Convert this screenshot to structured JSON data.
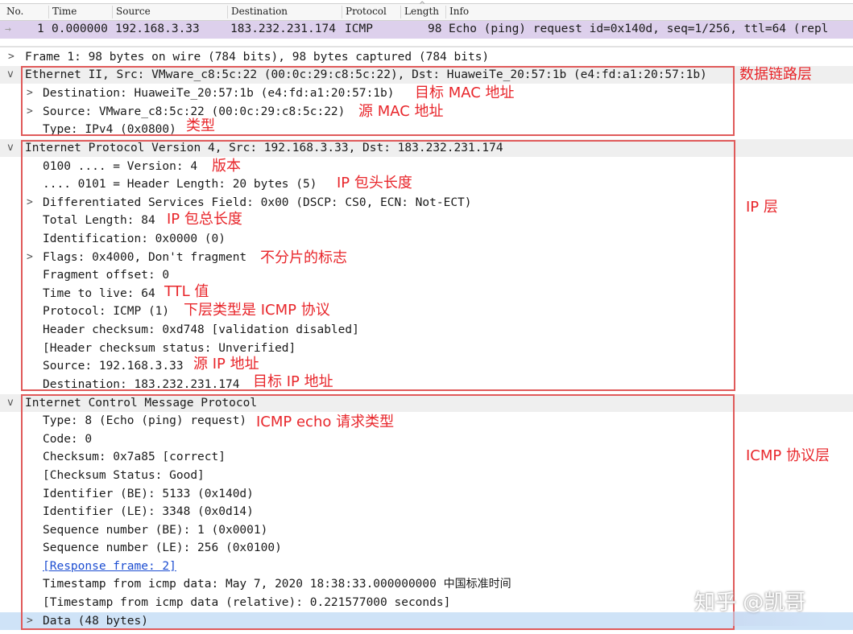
{
  "packet_list": {
    "columns": [
      "No.",
      "Time",
      "Source",
      "Destination",
      "Protocol",
      "Length",
      "Info"
    ],
    "selected_row": {
      "no": "1",
      "time": "0.000000",
      "source": "192.168.3.33",
      "destination": "183.232.231.174",
      "protocol": "ICMP",
      "length": "98",
      "info": "Echo (ping) request  id=0x140d, seq=1/256, ttl=64 (repl"
    }
  },
  "details": {
    "frame": "Frame 1: 98 bytes on wire (784 bits), 98 bytes captured (784 bits)",
    "ethernet": {
      "header": "Ethernet II, Src: VMware_c8:5c:22 (00:0c:29:c8:5c:22), Dst: HuaweiTe_20:57:1b (e4:fd:a1:20:57:1b)",
      "destination": "Destination: HuaweiTe_20:57:1b (e4:fd:a1:20:57:1b)",
      "source": "Source: VMware_c8:5c:22 (00:0c:29:c8:5c:22)",
      "type": "Type: IPv4 (0x0800)"
    },
    "ip": {
      "header": "Internet Protocol Version 4, Src: 192.168.3.33, Dst: 183.232.231.174",
      "version": "0100 .... = Version: 4",
      "header_length": ".... 0101 = Header Length: 20 bytes (5)",
      "dsfield": "Differentiated Services Field: 0x00 (DSCP: CS0, ECN: Not-ECT)",
      "total_length": "Total Length: 84",
      "identification": "Identification: 0x0000 (0)",
      "flags": "Flags: 0x4000, Don't fragment",
      "fragment_offset": "Fragment offset: 0",
      "ttl": "Time to live: 64",
      "protocol": "Protocol: ICMP (1)",
      "checksum": "Header checksum: 0xd748 [validation disabled]",
      "checksum_status": "[Header checksum status: Unverified]",
      "source": "Source: 192.168.3.33",
      "destination": "Destination: 183.232.231.174"
    },
    "icmp": {
      "header": "Internet Control Message Protocol",
      "type": "Type: 8 (Echo (ping) request)",
      "code": "Code: 0",
      "checksum": "Checksum: 0x7a85 [correct]",
      "checksum_status": "[Checksum Status: Good]",
      "identifier_be": "Identifier (BE): 5133 (0x140d)",
      "identifier_le": "Identifier (LE): 3348 (0x0d14)",
      "seq_be": "Sequence number (BE): 1 (0x0001)",
      "seq_le": "Sequence number (LE): 256 (0x0100)",
      "response_frame": "[Response frame: 2]",
      "timestamp": "Timestamp from icmp data: May  7, 2020 18:38:33.000000000 ",
      "timestamp_zone": "中国标准时间",
      "timestamp_rel": "[Timestamp from icmp data (relative): 0.221577000 seconds]",
      "data": "Data (48 bytes)"
    }
  },
  "annotations": {
    "data_link_layer": "数据链路层",
    "dst_mac": "目标 MAC 地址",
    "src_mac": "源 MAC 地址",
    "type": "类型",
    "version": "版本",
    "ip_header_length": "IP 包头长度",
    "ip_layer": "IP 层",
    "ip_total_length": "IP 包总长度",
    "no_fragment_flag": "不分片的标志",
    "ttl_value": "TTL 值",
    "lower_protocol": "下层类型是 ICMP 协议",
    "src_ip": "源 IP 地址",
    "dst_ip": "目标 IP 地址",
    "icmp_echo_type": "ICMP echo 请求类型",
    "icmp_layer": "ICMP 协议层"
  },
  "watermark": "知乎 @凯哥",
  "colors": {
    "selected_packet": "#ddd0ec",
    "annotation": "#e8262b",
    "box": "#e05a5a",
    "selected_detail": "#cfe3f7"
  }
}
